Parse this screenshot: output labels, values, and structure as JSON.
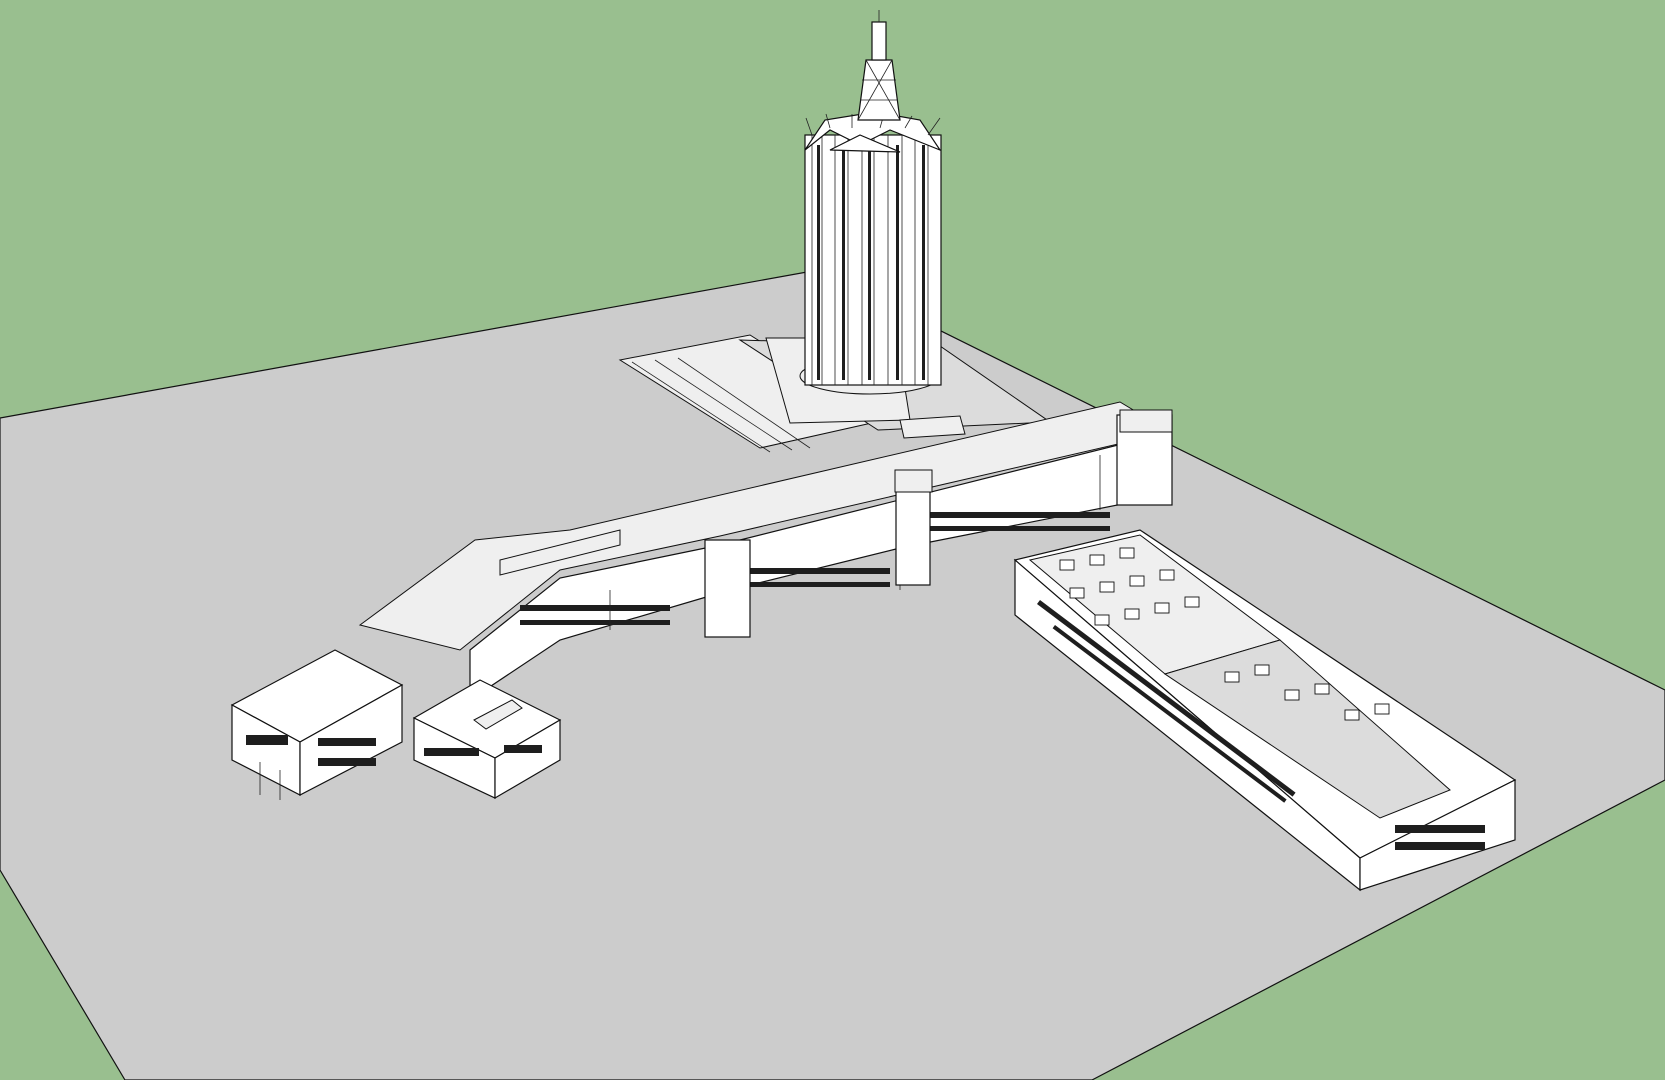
{
  "canvas": {
    "sky_color": "#99bf8f",
    "ground_color": "#cccccc",
    "line_color": "#111111",
    "surface_color": "#ffffff"
  },
  "model": {
    "icons": [
      "tower-icon",
      "antenna-icon",
      "building-icon"
    ]
  }
}
